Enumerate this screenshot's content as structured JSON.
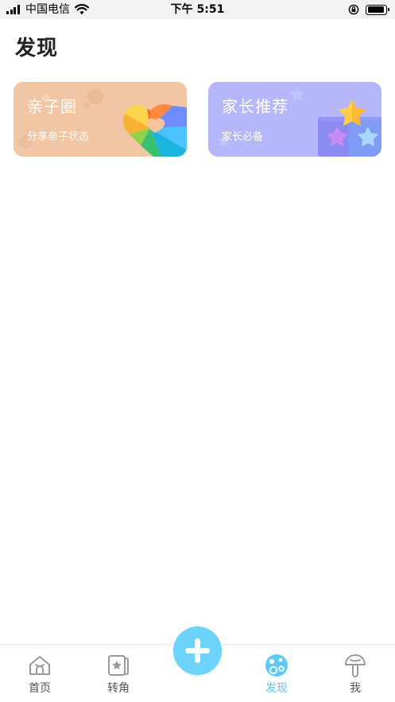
{
  "status_bar": {
    "carrier": "中国电信",
    "time": "下午 5:51"
  },
  "page": {
    "title": "发现"
  },
  "cards": [
    {
      "title": "亲子圈",
      "subtitle": "分享亲子状态"
    },
    {
      "title": "家长推荐",
      "subtitle": "家长必备"
    }
  ],
  "tab_bar": {
    "items": [
      {
        "label": "首页",
        "icon": "home-icon"
      },
      {
        "label": "转角",
        "icon": "album-star-icon"
      },
      {
        "label": "发现",
        "icon": "discover-icon",
        "active": true
      },
      {
        "label": "我",
        "icon": "mushroom-icon"
      }
    ],
    "add_icon": "plus-icon"
  },
  "colors": {
    "accent": "#5bc8f5",
    "add_button": "#6dd3fb",
    "card_family_bg": "#f1c6a4",
    "card_recommend_bg": "#b6b6fb",
    "status_bar_bg": "#f2f2f2"
  }
}
